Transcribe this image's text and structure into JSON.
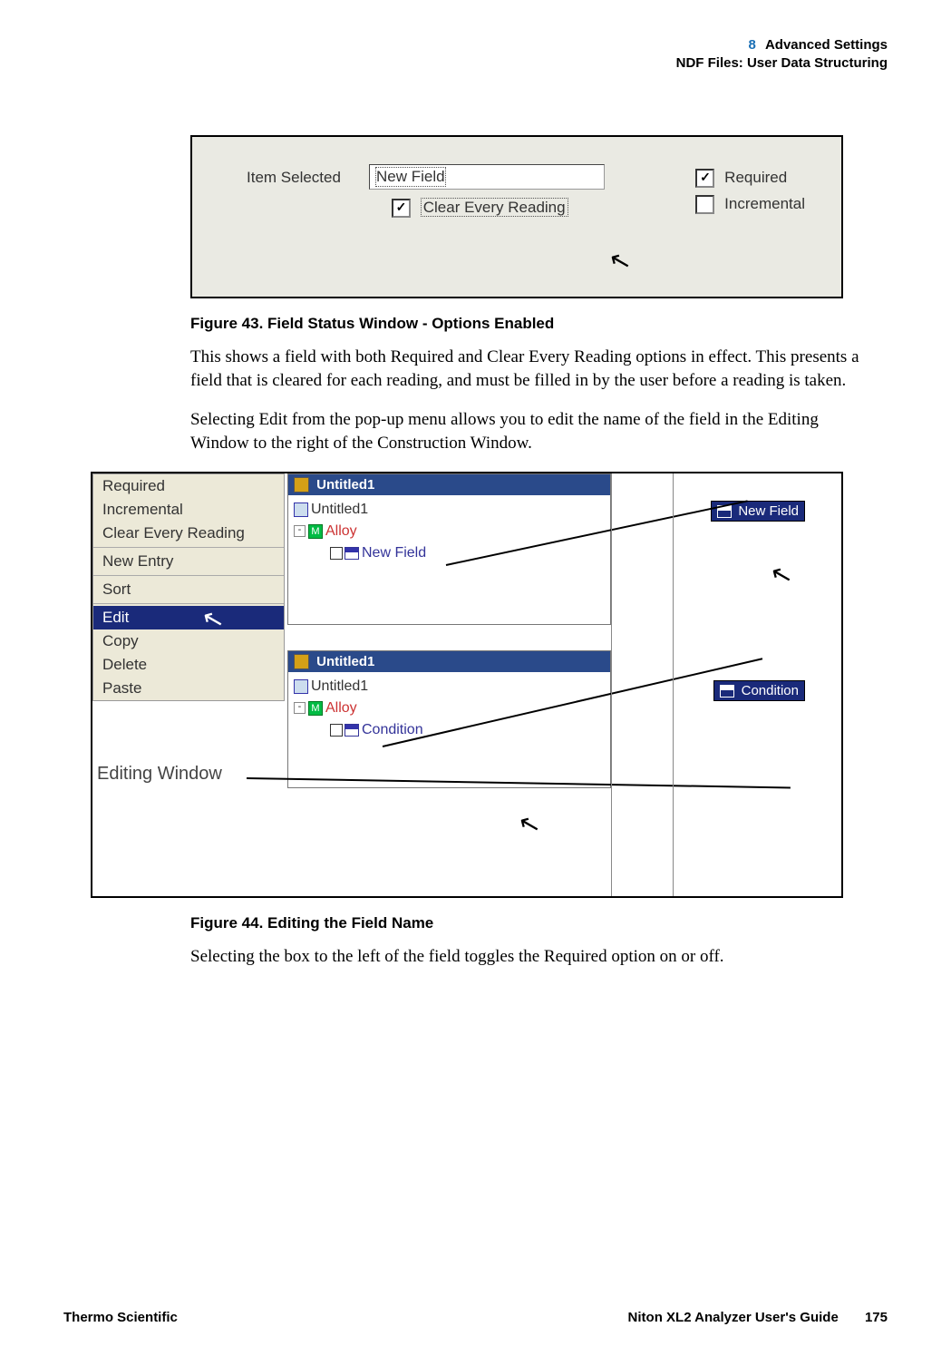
{
  "header": {
    "chapter_num": "8",
    "chapter_title": "Advanced Settings",
    "subtitle": "NDF Files: User Data Structuring"
  },
  "fig43": {
    "item_selected_label": "Item Selected",
    "field_value": "New Field",
    "clear_label": "Clear Every Reading",
    "required_label": "Required",
    "incremental_label": "Incremental",
    "caption": "Figure 43.   Field Status Window - Options Enabled"
  },
  "para1": "This shows a field with both Required and Clear Every Reading options in effect. This presents a field that is cleared for each reading, and must be filled in by the user before a reading is taken.",
  "para2": "Selecting Edit from the pop-up menu allows you to edit the name of the field in the Editing Window to the right of the Construction Window.",
  "fig44": {
    "menu": {
      "required": "Required",
      "incremental": "Incremental",
      "clear": "Clear Every Reading",
      "new_entry": "New Entry",
      "sort": "Sort",
      "edit": "Edit",
      "copy": "Copy",
      "delete": "Delete",
      "paste": "Paste"
    },
    "editing_window_label": "Editing Window",
    "panel_top": {
      "title": "Untitled1",
      "row1": "Untitled1",
      "alloy": "Alloy",
      "new_field": "New Field"
    },
    "panel_bottom": {
      "title": "Untitled1",
      "row1": "Untitled1",
      "alloy": "Alloy",
      "condition": "Condition"
    },
    "right_label_top": "New Field",
    "right_label_bottom": "Condition",
    "caption": "Figure 44.   Editing the Field Name"
  },
  "para3": "Selecting the box to the left of the field toggles the Required option on or off.",
  "footer": {
    "left": "Thermo Scientific",
    "right_title": "Niton XL2 Analyzer User's Guide",
    "page": "175"
  }
}
